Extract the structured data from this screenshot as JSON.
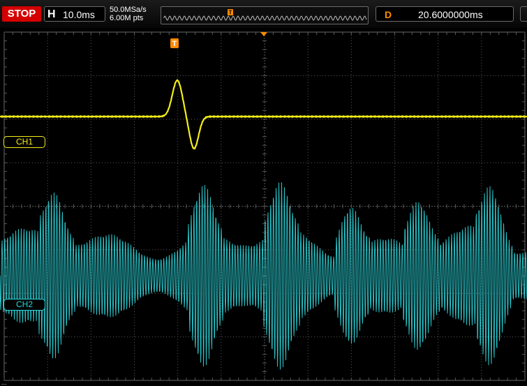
{
  "status": {
    "run_state": "STOP",
    "horizontal": {
      "label": "H",
      "value": "10.0ms"
    },
    "acquisition": {
      "sample_rate": "50.0MSa/s",
      "memory_depth": "6.00M pts"
    },
    "delay": {
      "label": "D",
      "value": "20.6000000ms"
    }
  },
  "markers": {
    "trigger_position_label": "T"
  },
  "channels": [
    {
      "id": "ch1",
      "label": "CH1",
      "color": "#f3ee19"
    },
    {
      "id": "ch2",
      "label": "CH2",
      "color": "#2dd6dc"
    }
  ],
  "colors": {
    "run_state_bg": "#d40000",
    "delay_label": "#ff8c00",
    "trigger_marker": "#ff8c00",
    "grid": "#5a5a5a"
  },
  "grid": {
    "columns": 12,
    "rows": 8,
    "visible": true
  },
  "footer": {
    "text": "..."
  }
}
